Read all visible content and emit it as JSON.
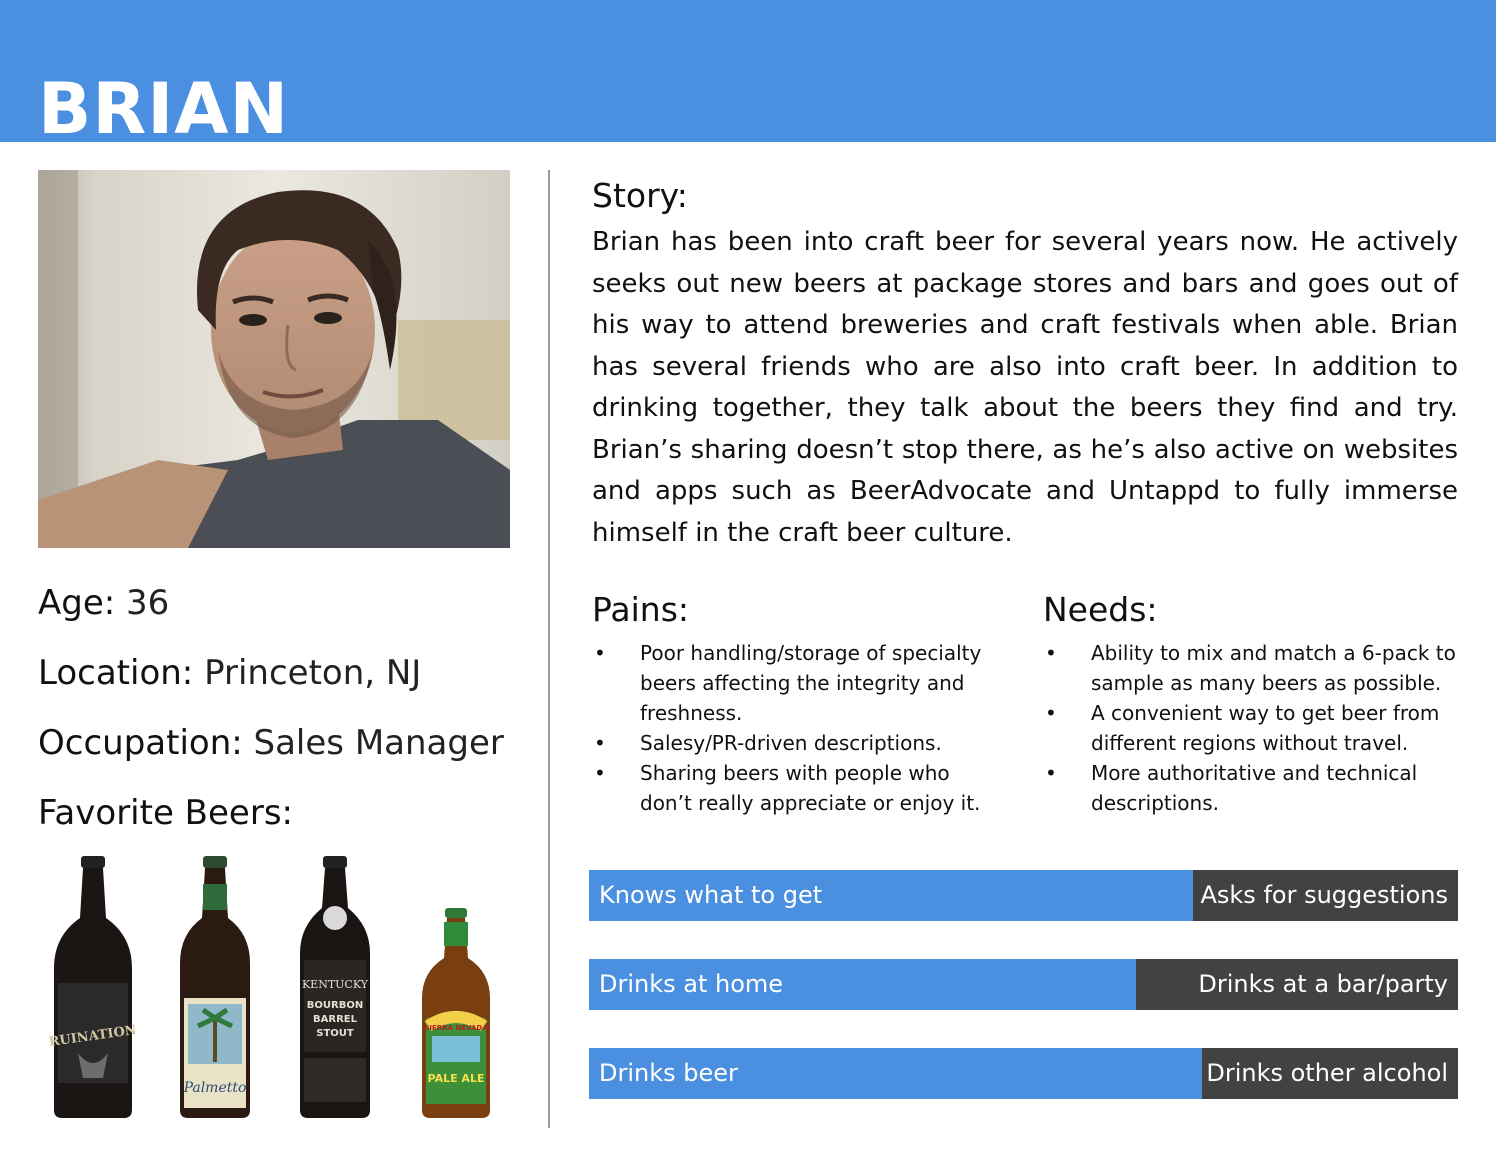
{
  "persona": {
    "name": "BRIAN",
    "age_label": "Age:",
    "age": "36",
    "location_label": "Location:",
    "location": "Princeton, NJ",
    "occupation_label": "Occupation:",
    "occupation": "Sales Manager",
    "favorite_beers_label": "Favorite Beers:"
  },
  "story": {
    "title": "Story:",
    "text": "Brian has been into craft beer for several years now. He actively seeks out new beers at package stores and bars and goes out of his way to attend breweries and craft festivals when able. Brian has several friends who are also into craft beer. In addition to drinking together, they talk about the beers they find and try. Brian’s sharing doesn’t stop there, as he’s also active on websites and apps such as BeerAdvocate and Untappd to fully immerse himself in the craft beer culture."
  },
  "pains": {
    "title": "Pains:",
    "items": [
      "Poor handling/storage of specialty beers affecting the integrity and freshness.",
      "Salesy/PR-driven descriptions.",
      "Sharing beers with people who don’t really appreciate or enjoy it."
    ]
  },
  "needs": {
    "title": "Needs:",
    "items": [
      "Ability to mix and match a 6-pack to sample as many beers as possible.",
      "A convenient way to get beer from different regions without travel.",
      "More authoritative and technical descriptions."
    ]
  },
  "spectrums": [
    {
      "left": "Knows what to get",
      "right": "Asks for suggestions",
      "fraction": 0.695
    },
    {
      "left": "Drinks at home",
      "right": "Drinks at a bar/party",
      "fraction": 0.63
    },
    {
      "left": "Drinks beer",
      "right": "Drinks other alcohol",
      "fraction": 0.705
    }
  ],
  "beer_labels": [
    {
      "icon": "beer-bottle-icon",
      "text": "RUINATION"
    },
    {
      "icon": "beer-bottle-icon",
      "text": "Palmetto"
    },
    {
      "icon": "beer-bottle-icon",
      "text": "KENTUCKY BOURBON BARREL STOUT"
    },
    {
      "icon": "beer-bottle-icon",
      "text": "SIERRA NEVADA PALE ALE"
    }
  ],
  "colors": {
    "accent_blue": "#4a8fe0",
    "dark_gray": "#424242",
    "white": "#ffffff"
  }
}
